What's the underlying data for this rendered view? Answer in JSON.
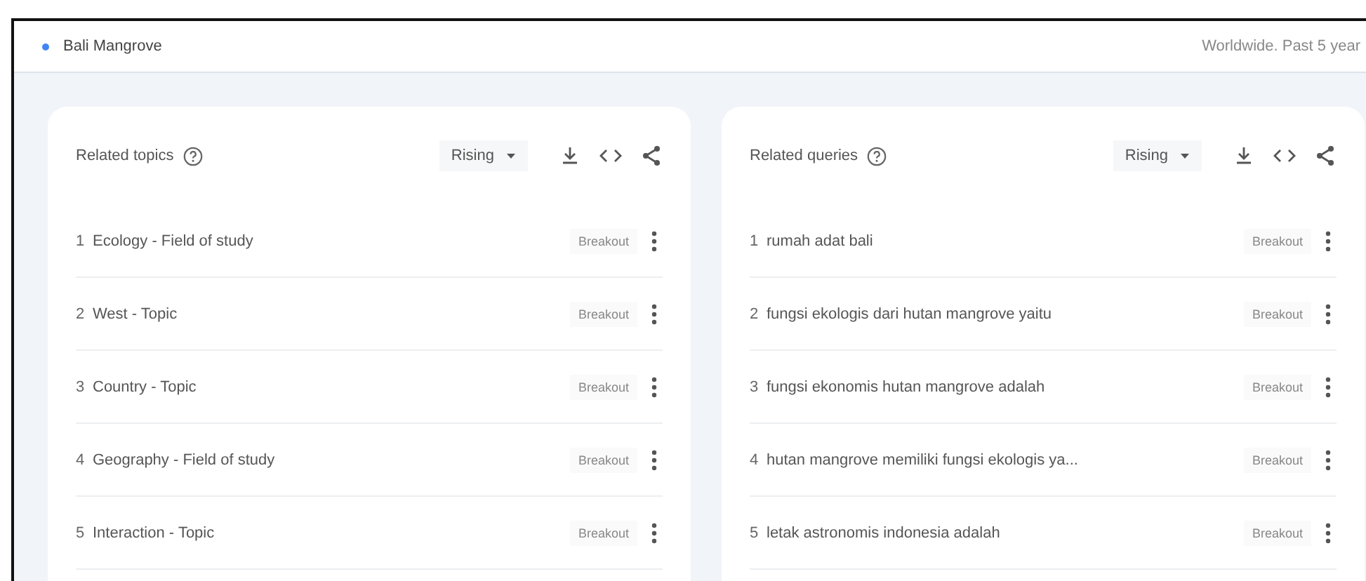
{
  "top_bar": {
    "term": "Bali Mangrove",
    "scope": "Worldwide. Past 5 year"
  },
  "panels": [
    {
      "title": "Related topics",
      "filter": "Rising",
      "rows": [
        {
          "rank": "1",
          "label": "Ecology - Field of study",
          "value": "Breakout"
        },
        {
          "rank": "2",
          "label": "West - Topic",
          "value": "Breakout"
        },
        {
          "rank": "3",
          "label": "Country - Topic",
          "value": "Breakout"
        },
        {
          "rank": "4",
          "label": "Geography - Field of study",
          "value": "Breakout"
        },
        {
          "rank": "5",
          "label": "Interaction - Topic",
          "value": "Breakout"
        }
      ]
    },
    {
      "title": "Related queries",
      "filter": "Rising",
      "rows": [
        {
          "rank": "1",
          "label": "rumah adat bali",
          "value": "Breakout"
        },
        {
          "rank": "2",
          "label": "fungsi ekologis dari hutan mangrove yaitu",
          "value": "Breakout"
        },
        {
          "rank": "3",
          "label": "fungsi ekonomis hutan mangrove adalah",
          "value": "Breakout"
        },
        {
          "rank": "4",
          "label": "hutan mangrove memiliki fungsi ekologis ya...",
          "value": "Breakout"
        },
        {
          "rank": "5",
          "label": "letak astronomis indonesia adalah",
          "value": "Breakout"
        }
      ]
    }
  ]
}
